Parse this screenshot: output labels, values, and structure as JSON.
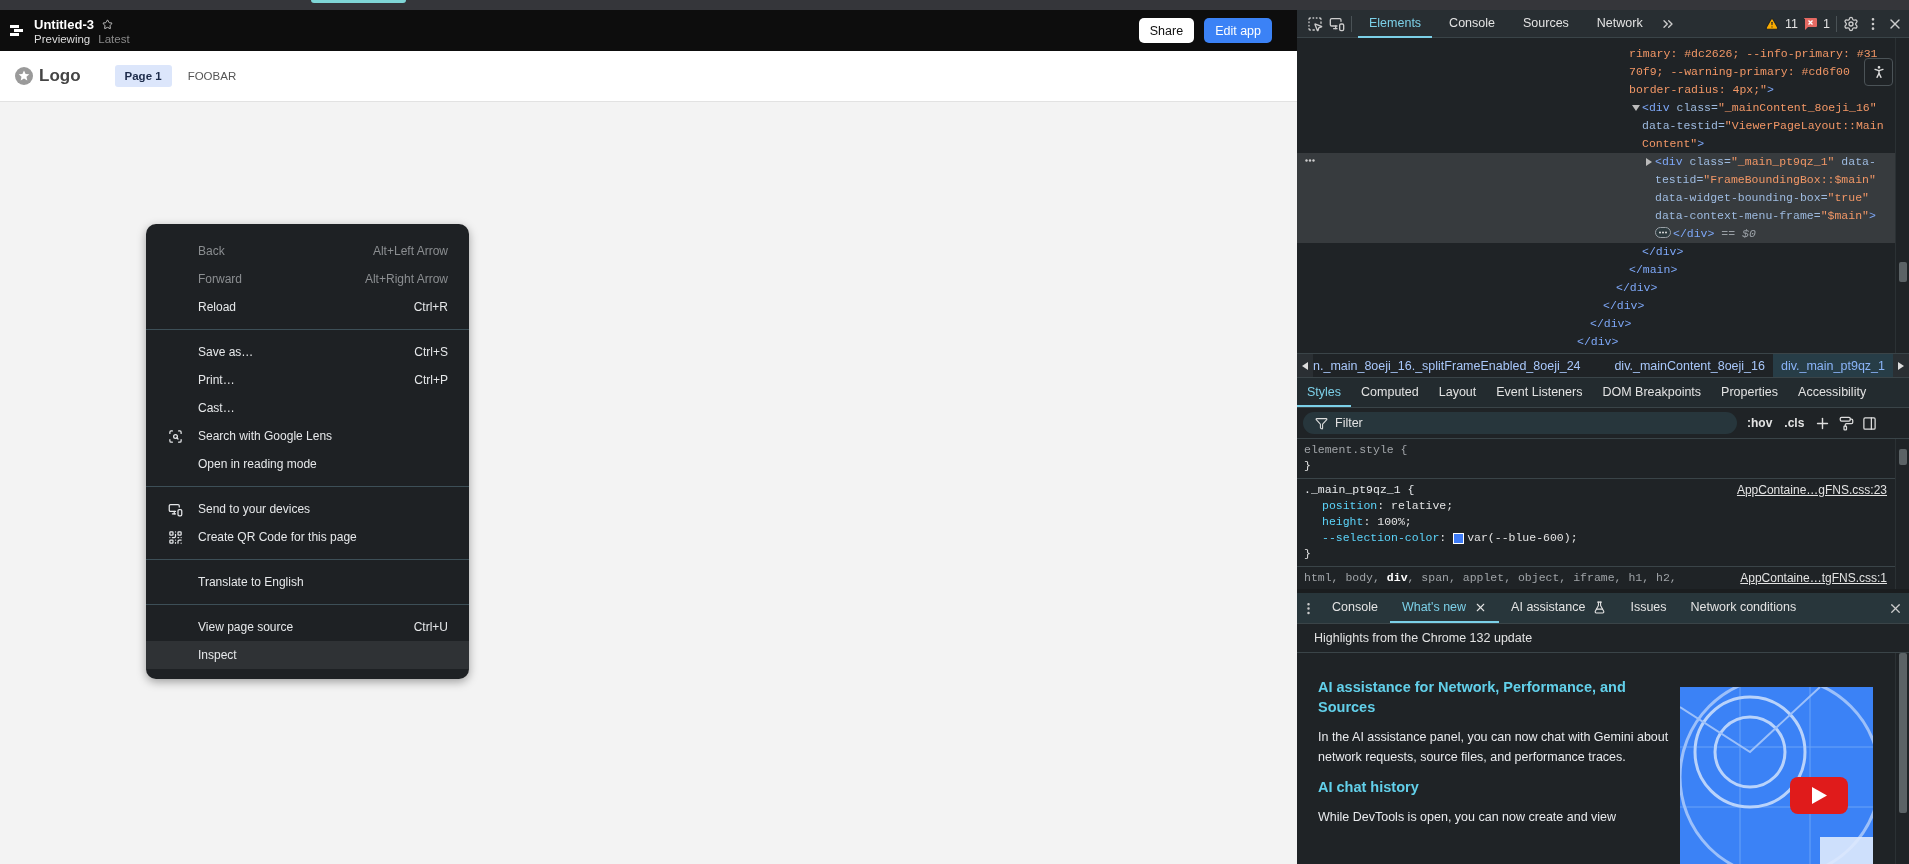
{
  "app": {
    "title": "Untitled-3",
    "status": "Previewing",
    "version": "Latest",
    "buttons": [
      {
        "label": "Share",
        "kind": "secondary"
      },
      {
        "label": "Edit app",
        "kind": "primary"
      }
    ],
    "nav": {
      "logo": "Logo",
      "pages": [
        {
          "label": "Page 1",
          "selected": true
        },
        {
          "label": "FOOBAR",
          "selected": false
        }
      ]
    }
  },
  "context_menu": {
    "groups": [
      [
        {
          "label": "Back",
          "shortcut": "Alt+Left Arrow",
          "disabled": true,
          "highlighted": false,
          "kind": "plain"
        },
        {
          "label": "Forward",
          "shortcut": "Alt+Right Arrow",
          "disabled": true,
          "highlighted": false,
          "kind": "plain"
        },
        {
          "label": "Reload",
          "shortcut": "Ctrl+R",
          "disabled": false,
          "highlighted": false,
          "kind": "plain"
        }
      ],
      [
        {
          "label": "Save as…",
          "shortcut": "Ctrl+S",
          "disabled": false,
          "highlighted": false,
          "kind": "plain"
        },
        {
          "label": "Print…",
          "shortcut": "Ctrl+P",
          "disabled": false,
          "highlighted": false,
          "kind": "plain"
        },
        {
          "label": "Cast…",
          "disabled": false,
          "highlighted": false,
          "kind": "plain"
        },
        {
          "label": "Search with Google Lens",
          "disabled": false,
          "highlighted": false,
          "kind": "lens"
        },
        {
          "label": "Open in reading mode",
          "disabled": false,
          "highlighted": false,
          "kind": "plain"
        }
      ],
      [
        {
          "label": "Send to your devices",
          "disabled": false,
          "highlighted": false,
          "kind": "devices"
        },
        {
          "label": "Create QR Code for this page",
          "disabled": false,
          "highlighted": false,
          "kind": "qr"
        }
      ],
      [
        {
          "label": "Translate to English",
          "disabled": false,
          "highlighted": false,
          "kind": "plain"
        }
      ],
      [
        {
          "label": "View page source",
          "shortcut": "Ctrl+U",
          "disabled": false,
          "highlighted": false,
          "kind": "plain"
        },
        {
          "label": "Inspect",
          "disabled": false,
          "highlighted": true,
          "kind": "plain"
        }
      ]
    ]
  },
  "devtools": {
    "toolbar": {
      "tabs": [
        {
          "label": "Elements",
          "selected": true
        },
        {
          "label": "Console",
          "selected": false
        },
        {
          "label": "Sources",
          "selected": false
        },
        {
          "label": "Network",
          "selected": false
        }
      ],
      "warnings": "11",
      "errors": "1"
    },
    "elements": {
      "tree": [
        {
          "closing": [
            {
              "kind": "tag",
              "text": "</div>"
            }
          ],
          "children": [
            {
              "closing": [
                {
                  "kind": "tag",
                  "text": "</div>"
                }
              ],
              "children": [
                {
                  "closing": [
                    {
                      "kind": "tag",
                      "text": "</div>"
                    }
                  ],
                  "children": [
                    {
                      "closing": [
                        {
                          "kind": "tag",
                          "text": "</div>"
                        }
                      ],
                      "children": [
                        {
                          "selected": false,
                          "lines": [
                            [
                              {
                                "kind": "value",
                                "text": "rimary: #dc2626; --info-primary: #31"
                              }
                            ],
                            [
                              {
                                "kind": "value",
                                "text": "70f9; --warning-primary: #cd6f00"
                              }
                            ],
                            [
                              {
                                "kind": "value",
                                "text": "border-radius: 4px;\""
                              },
                              {
                                "kind": "tag",
                                "text": ">"
                              }
                            ]
                          ],
                          "closing": [
                            {
                              "kind": "tag",
                              "text": "</main>"
                            }
                          ],
                          "children": [
                            {
                              "selected": false,
                              "expanded": true,
                              "lines": [
                                [
                                  {
                                    "kind": "tag",
                                    "text": "<div"
                                  },
                                  {
                                    "kind": "attr",
                                    "text": " class="
                                  },
                                  {
                                    "kind": "value",
                                    "text": "\"_mainContent_8oeji_16\""
                                  }
                                ],
                                [
                                  {
                                    "kind": "attr",
                                    "text": "data-testid="
                                  },
                                  {
                                    "kind": "value",
                                    "text": "\"ViewerPageLayout::Main"
                                  }
                                ],
                                [
                                  {
                                    "kind": "value",
                                    "text": "Content\""
                                  },
                                  {
                                    "kind": "tag",
                                    "text": ">"
                                  }
                                ]
                              ],
                              "closing": [
                                {
                                  "kind": "tag",
                                  "text": "</div>"
                                }
                              ],
                              "children": [
                                {
                                  "selected": true,
                                  "expanded": false,
                                  "lines": [
                                    [
                                      {
                                        "kind": "tag",
                                        "text": "<div"
                                      },
                                      {
                                        "kind": "attr",
                                        "text": " class="
                                      },
                                      {
                                        "kind": "value",
                                        "text": "\"_main_pt9qz_1\""
                                      },
                                      {
                                        "kind": "attr",
                                        "text": " data-"
                                      }
                                    ],
                                    [
                                      {
                                        "kind": "attr",
                                        "text": "testid="
                                      },
                                      {
                                        "kind": "value",
                                        "text": "\"FrameBoundingBox::$main\""
                                      }
                                    ],
                                    [
                                      {
                                        "kind": "attr",
                                        "text": "data-widget-bounding-box="
                                      },
                                      {
                                        "kind": "value",
                                        "text": "\"true\""
                                      }
                                    ],
                                    [
                                      {
                                        "kind": "attr",
                                        "text": "data-context-menu-frame="
                                      },
                                      {
                                        "kind": "value",
                                        "text": "\"$main\""
                                      },
                                      {
                                        "kind": "tag",
                                        "text": ">"
                                      }
                                    ],
                                    [
                                      {
                                        "kind": "ellipsis"
                                      },
                                      {
                                        "kind": "tag",
                                        "text": "</div>"
                                      },
                                      {
                                        "kind": "note",
                                        "text": " == $0"
                                      }
                                    ]
                                  ]
                                }
                              ]
                            }
                          ]
                        }
                      ]
                    }
                  ]
                }
              ]
            }
          ]
        }
      ]
    },
    "breadcrumbs": [
      {
        "label": "n._main_8oeji_16._splitFrameEnabled_8oeji_24",
        "selected": false
      },
      {
        "label": "div._mainContent_8oeji_16",
        "selected": false
      },
      {
        "label": "div._main_pt9qz_1",
        "selected": true
      }
    ],
    "styles": {
      "tabs": [
        {
          "label": "Styles",
          "selected": true
        },
        {
          "label": "Computed",
          "selected": false
        },
        {
          "label": "Layout",
          "selected": false
        },
        {
          "label": "Event Listeners",
          "selected": false
        },
        {
          "label": "DOM Breakpoints",
          "selected": false
        },
        {
          "label": "Properties",
          "selected": false
        },
        {
          "label": "Accessibility",
          "selected": false
        }
      ],
      "filter": {
        "placeholder": "Filter"
      },
      "toggles": [
        ":hov",
        ".cls"
      ],
      "rules": [
        {
          "kind": "inline",
          "selector": "element.style",
          "open": " {",
          "close": "}"
        },
        {
          "kind": "class",
          "selector": "._main_pt9qz_1",
          "open": " {",
          "source": "AppContaine…gFNS.css:23",
          "declarations": [
            {
              "name": "position",
              "colon": ": ",
              "value": "relative;"
            },
            {
              "name": "height",
              "colon": ": ",
              "value": "100%;"
            },
            {
              "name": "--selection-color",
              "colon": ": ",
              "color": "#3e7bf6",
              "value": "var(--blue-600);"
            }
          ],
          "close": "}"
        },
        {
          "kind": "tag",
          "selector": "html, body, **div**, span, applet, object, iframe, h1, h2,",
          "source": "AppContaine…tgFNS.css:1"
        }
      ]
    },
    "drawer": {
      "tabs": [
        {
          "label": "Console",
          "selected": false,
          "kind": "plain"
        },
        {
          "label": "What's new",
          "selected": true,
          "kind": "closable"
        },
        {
          "label": "AI assistance",
          "selected": false,
          "kind": "experimental"
        },
        {
          "label": "Issues",
          "selected": false,
          "kind": "plain"
        },
        {
          "label": "Network conditions",
          "selected": false,
          "kind": "plain"
        }
      ],
      "header": "Highlights from the Chrome 132 update",
      "article": [
        {
          "kind": "heading",
          "text": "AI assistance for Network, Performance, and Sources"
        },
        {
          "kind": "paragraph",
          "text": "In the AI assistance panel, you can now chat with Gemini about network requests, source files, and performance traces."
        },
        {
          "kind": "heading",
          "text": "AI chat history"
        },
        {
          "kind": "paragraph",
          "text": "While DevTools is open, you can now create and view"
        }
      ]
    }
  }
}
